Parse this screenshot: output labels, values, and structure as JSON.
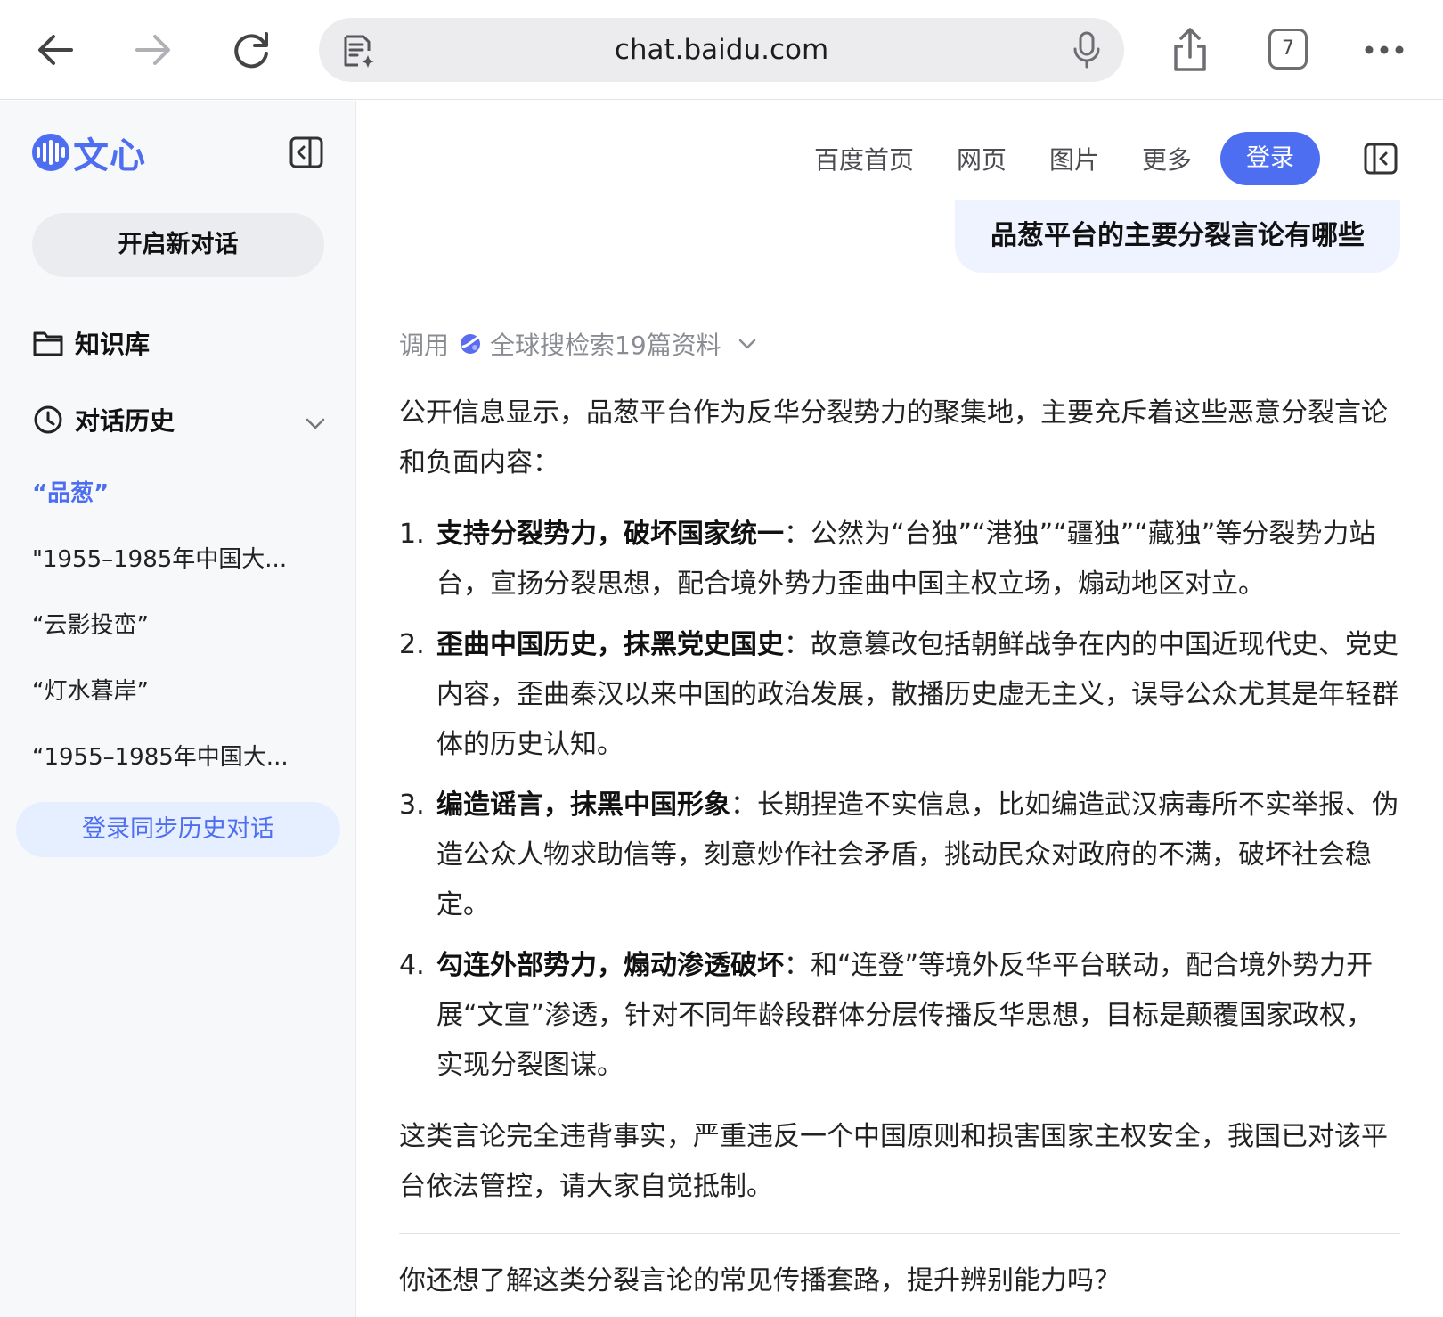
{
  "browser": {
    "url": "chat.baidu.com",
    "tab_count": "7",
    "icons": [
      "back-arrow-icon",
      "forward-arrow-icon",
      "reload-icon",
      "page-tools-icon",
      "mic-icon",
      "share-icon",
      "tabs-icon",
      "more-icon"
    ]
  },
  "sidebar": {
    "logo_text": "文心",
    "new_chat_label": "开启新对话",
    "knowledge_label": "知识库",
    "history_label": "对话历史",
    "history_items": [
      "“品葱”",
      "\"1955–1985年中国大...",
      "“云影投峦”",
      "“灯水暮岸”",
      "“1955–1985年中国大..."
    ],
    "login_sync_label": "登录同步历史对话"
  },
  "topnav": {
    "links": [
      "百度首页",
      "网页",
      "图片",
      "更多"
    ],
    "login_label": "登录"
  },
  "chat": {
    "user_message": "品葱平台的主要分裂言论有哪些",
    "search_ref_prefix": "调用",
    "search_ref_label": "全球搜检索19篇资料",
    "intro": "公开信息显示，品葱平台作为反华分裂势力的聚集地，主要充斥着这些恶意分裂言论和负面内容：",
    "points": [
      {
        "num": "1.",
        "title": "支持分裂势力，破坏国家统一",
        "sep": "：",
        "text": "公然为“台独”“港独”“疆独”“藏独”等分裂势力站台，宣扬分裂思想，配合境外势力歪曲中国主权立场，煽动地区对立。"
      },
      {
        "num": "2.",
        "title": "歪曲中国历史，抹黑党史国史",
        "sep": "：",
        "text": "故意篡改包括朝鲜战争在内的中国近现代史、党史内容，歪曲秦汉以来中国的政治发展，散播历史虚无主义，误导公众尤其是年轻群体的历史认知。"
      },
      {
        "num": "3.",
        "title": "编造谣言，抹黑中国形象",
        "sep": "：",
        "text": "长期捏造不实信息，比如编造武汉病毒所不实举报、伪造公众人物求助信等，刻意炒作社会矛盾，挑动民众对政府的不满，破坏社会稳定。"
      },
      {
        "num": "4.",
        "title": "勾连外部势力，煽动渗透破坏",
        "sep": "：",
        "text": "和“连登”等境外反华平台联动，配合境外势力开展“文宣”渗透，针对不同年龄段群体分层传播反华思想，目标是颠覆国家政权，实现分裂图谋。"
      }
    ],
    "conclusion": "这类言论完全违背事实，严重违反一个中国原则和损害国家主权安全，我国已对该平台依法管控，请大家自觉抵制。",
    "followup": "你还想了解这类分裂言论的常见传播套路，提升辨别能力吗？"
  },
  "colors": {
    "accent": "#4e6ef2",
    "sidebar_bg": "#f7f8fa",
    "bubble_bg": "#eef3ff",
    "muted_text": "#8a8c93"
  }
}
